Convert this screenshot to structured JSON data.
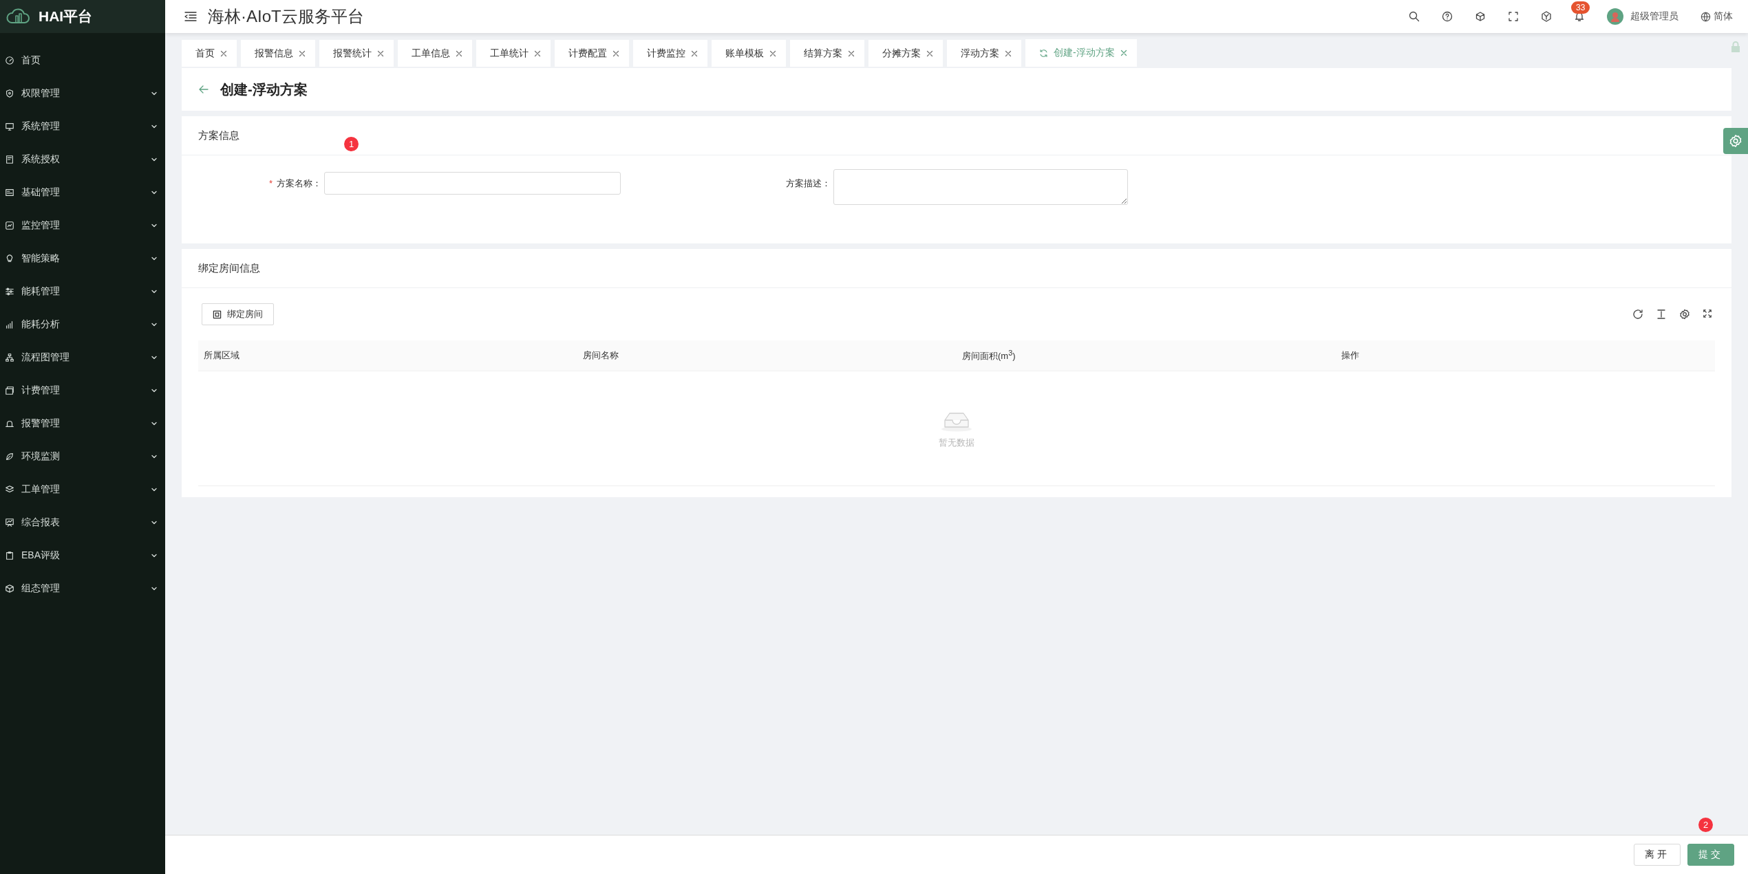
{
  "sidebar": {
    "logo_text": "HAI平台",
    "items": [
      {
        "label": "首页",
        "kind": "link"
      },
      {
        "label": "权限管理",
        "kind": "group",
        "expanded": false
      },
      {
        "label": "系统管理",
        "kind": "group",
        "expanded": false
      },
      {
        "label": "系统授权",
        "kind": "group",
        "expanded": false
      },
      {
        "label": "基础管理",
        "kind": "group",
        "expanded": false
      },
      {
        "label": "监控管理",
        "kind": "group",
        "expanded": false
      },
      {
        "label": "智能策略",
        "kind": "group",
        "expanded": false
      },
      {
        "label": "能耗管理",
        "kind": "group",
        "expanded": false
      },
      {
        "label": "能耗分析",
        "kind": "group",
        "expanded": false
      },
      {
        "label": "流程图管理",
        "kind": "group",
        "expanded": false
      },
      {
        "label": "计费管理",
        "kind": "group",
        "expanded": false
      },
      {
        "label": "报警管理",
        "kind": "group",
        "expanded": false
      },
      {
        "label": "环境监测",
        "kind": "group",
        "expanded": false
      },
      {
        "label": "工单管理",
        "kind": "group",
        "expanded": false
      },
      {
        "label": "综合报表",
        "kind": "group",
        "expanded": false
      },
      {
        "label": "EBA评级",
        "kind": "group",
        "expanded": false
      },
      {
        "label": "组态管理",
        "kind": "group",
        "expanded": false
      }
    ]
  },
  "header": {
    "title": "海林·AIoT云服务平台",
    "notification_count": "33",
    "user": "超级管理员",
    "language": "简体"
  },
  "tabs": [
    {
      "label": "首页",
      "selected": false
    },
    {
      "label": "报警信息",
      "selected": false
    },
    {
      "label": "报警统计",
      "selected": false
    },
    {
      "label": "工单信息",
      "selected": false
    },
    {
      "label": "工单统计",
      "selected": false
    },
    {
      "label": "计费配置",
      "selected": false
    },
    {
      "label": "计费监控",
      "selected": false
    },
    {
      "label": "账单模板",
      "selected": false
    },
    {
      "label": "结算方案",
      "selected": false
    },
    {
      "label": "分摊方案",
      "selected": false
    },
    {
      "label": "浮动方案",
      "selected": false
    },
    {
      "label": "创建-浮动方案",
      "selected": true
    }
  ],
  "page": {
    "title": "创建-浮动方案"
  },
  "plan_info": {
    "title": "方案信息",
    "marker": "1",
    "fields": [
      {
        "kind": "input",
        "label": "方案名称：",
        "required_mark": "*"
      },
      {
        "kind": "textarea",
        "label": "方案描述："
      }
    ]
  },
  "rooms": {
    "title": "绑定房间信息",
    "bind_button": "绑定房间",
    "columns": [
      "所属区域",
      "房间名称",
      "房间面积(m$^{3}$)",
      "操作"
    ],
    "empty_text": "暂无数据"
  },
  "footer": {
    "marker": "2",
    "buttons": [
      {
        "label": "离开",
        "kind": "default"
      },
      {
        "label": "提交",
        "kind": "primary"
      }
    ]
  }
}
